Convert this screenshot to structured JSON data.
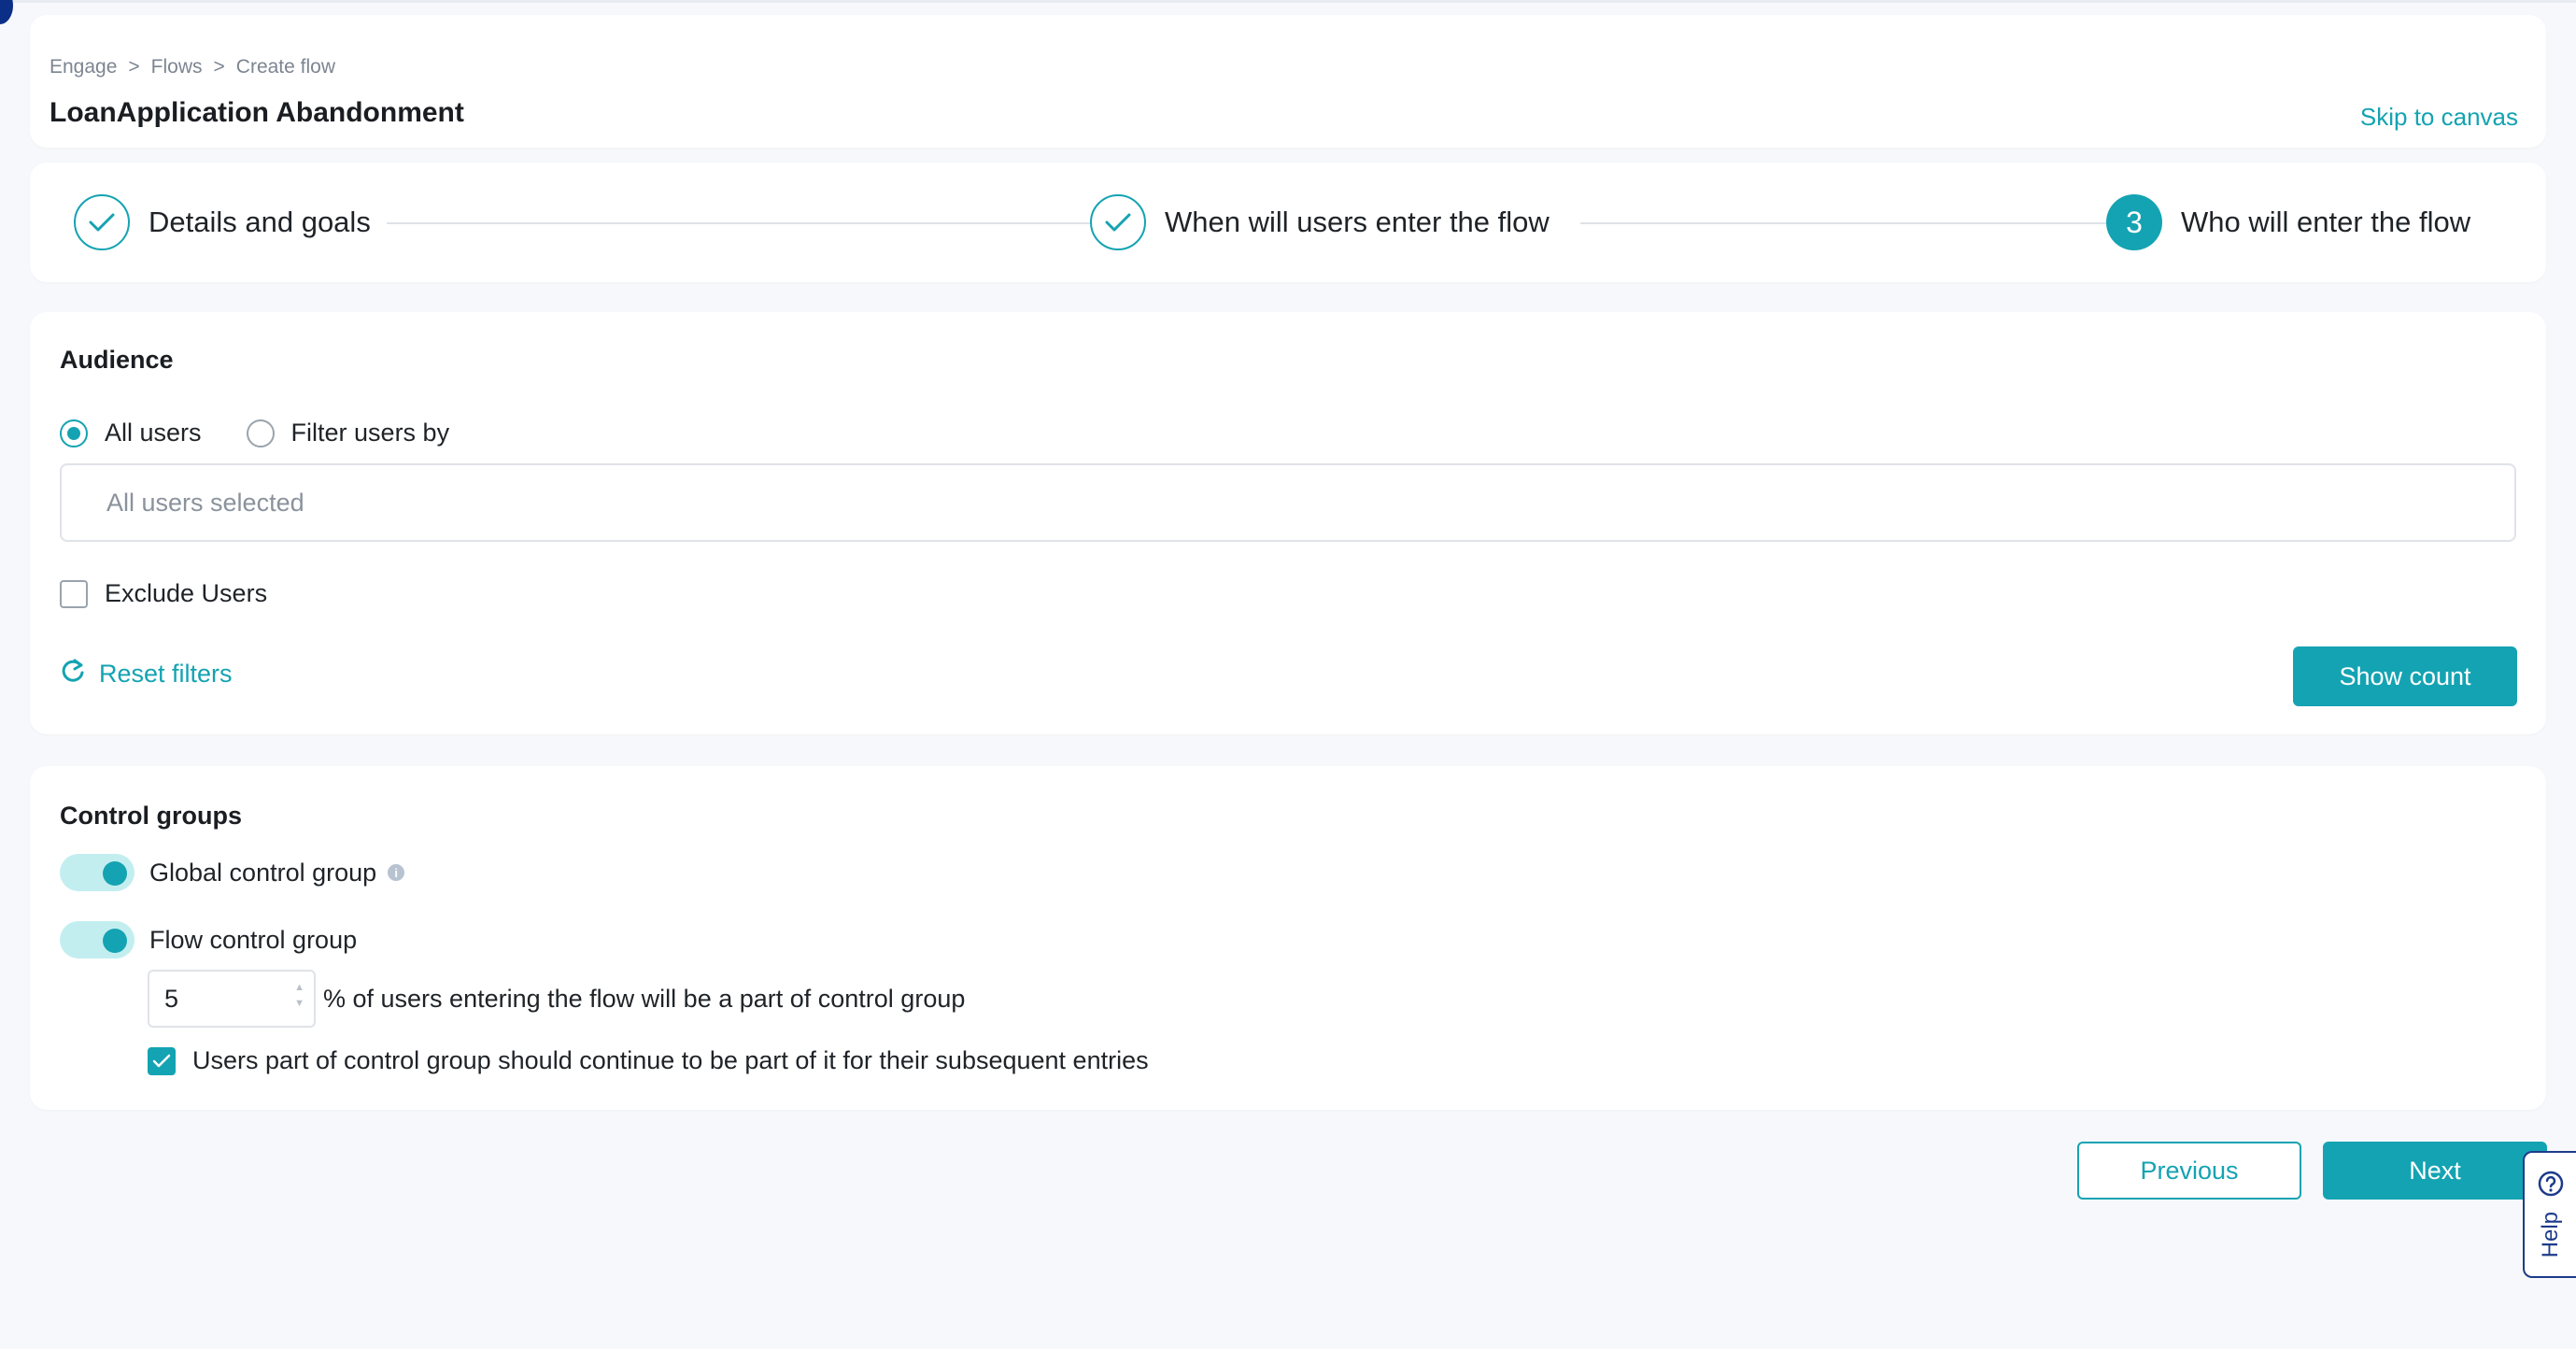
{
  "breadcrumb": {
    "items": [
      "Engage",
      "Flows",
      "Create flow"
    ],
    "separator": ">"
  },
  "header": {
    "title": "LoanApplication Abandonment",
    "skip_link": "Skip to canvas"
  },
  "stepper": {
    "steps": [
      {
        "label": "Details and goals",
        "state": "done"
      },
      {
        "label": "When will users enter the flow",
        "state": "done"
      },
      {
        "label": "Who will enter the flow",
        "state": "active",
        "number": "3"
      }
    ]
  },
  "audience": {
    "title": "Audience",
    "options": [
      {
        "label": "All users",
        "checked": true
      },
      {
        "label": "Filter users by",
        "checked": false
      }
    ],
    "filter_placeholder": "All users selected",
    "exclude_label": "Exclude Users",
    "reset_label": "Reset filters",
    "show_count_label": "Show count"
  },
  "control_groups": {
    "title": "Control groups",
    "global_label": "Global control group",
    "global_enabled": true,
    "flow_label": "Flow control group",
    "flow_enabled": true,
    "percent_value": "5",
    "percent_suffix": "% of users entering the flow will be a part of control group",
    "continue_label": "Users part of control group should continue to be part of it for their subsequent entries",
    "continue_checked": true
  },
  "footer": {
    "previous_label": "Previous",
    "next_label": "Next"
  },
  "help": {
    "label": "Help"
  },
  "colors": {
    "accent": "#14a3b2",
    "help_border": "#1d3b8a",
    "background": "#f6f8fb"
  }
}
